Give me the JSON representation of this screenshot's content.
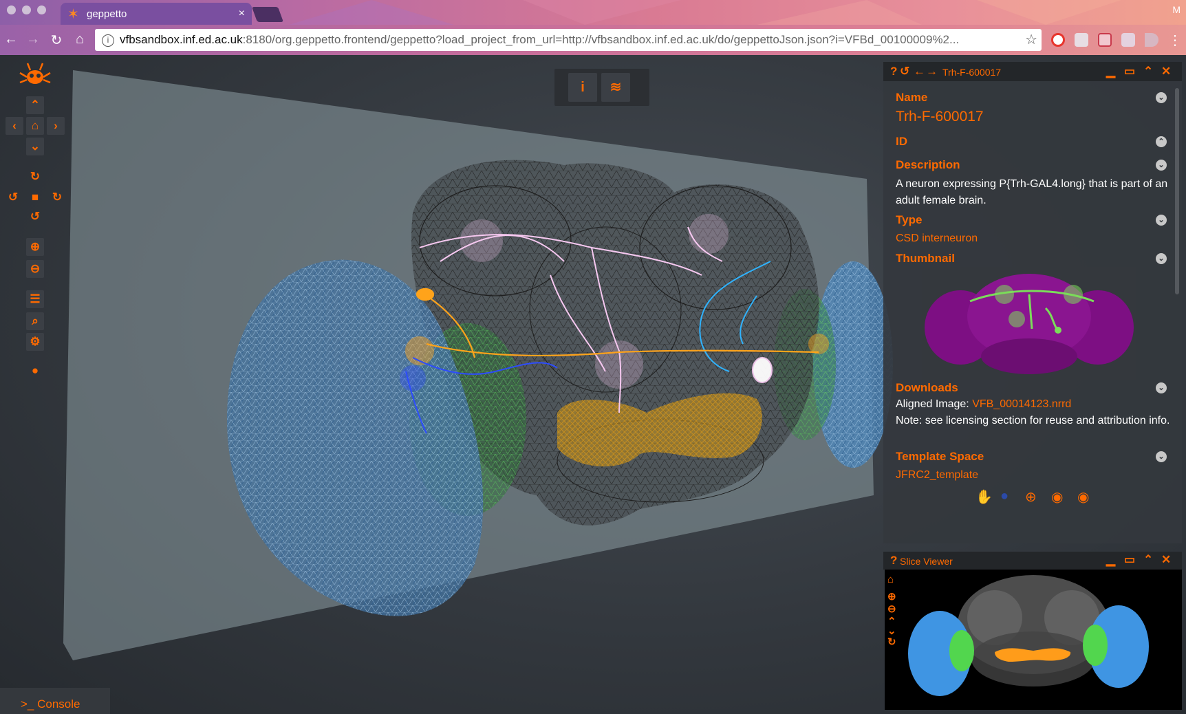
{
  "browser": {
    "tab_title": "geppetto",
    "tab_close": "×",
    "profile_initial": "M",
    "url_host": "vfbsandbox.inf.ed.ac.uk",
    "url_rest": ":8180/org.geppetto.frontend/geppetto?load_project_from_url=http://vfbsandbox.inf.ed.ac.uk/do/geppettoJson.json?i=VFBd_00100009%2..."
  },
  "console": {
    "label": ">_  Console"
  },
  "info_panel": {
    "header_title": "Trh-F-600017",
    "name_label": "Name",
    "name_value": "Trh-F-600017",
    "id_label": "ID",
    "description_label": "Description",
    "description_value": "A neuron expressing P{Trh-GAL4.long} that is part of an adult female brain.",
    "type_label": "Type",
    "type_value": "CSD interneuron",
    "thumbnail_label": "Thumbnail",
    "downloads_label": "Downloads",
    "aligned_image_prefix": "Aligned Image: ",
    "aligned_image_link": "VFB_00014123.nrrd",
    "note_text": "Note: see licensing section for reuse and attribution info.",
    "template_space_label": "Template Space",
    "template_space_value": "JFRC2_template"
  },
  "slice_viewer": {
    "title": "Slice Viewer"
  },
  "colors": {
    "accent": "#ff6a00",
    "panel_bg": "#34383d",
    "header_bg": "#232629",
    "neuron_pink": "#f6c8f0",
    "neuron_orange": "#ffa31a",
    "neuron_blue": "#2d4cff",
    "neuron_cyan": "#2fb3ff",
    "lobe_blue": "#5a8ec0",
    "lobe_green": "#56c05a",
    "mesh_gray": "#2a2a2a",
    "ellipsoid_orange": "#e4ad2d"
  },
  "icons": {
    "toolbar": [
      "up-arrow-icon",
      "left-arrow-icon",
      "home-icon",
      "right-arrow-icon",
      "down-arrow-icon",
      "rotate-up-icon",
      "rotate-left-icon",
      "camera-icon",
      "rotate-right-icon",
      "rotate-down-icon",
      "zoom-in-icon",
      "zoom-out-icon",
      "list-icon",
      "search-icon",
      "settings-icon",
      "github-icon"
    ],
    "panel_header": [
      "help-icon",
      "history-icon",
      "back-icon",
      "forward-icon",
      "minimize-icon",
      "maximize-icon",
      "collapse-icon",
      "close-icon"
    ],
    "panel_footer": [
      "hand-icon",
      "color-drop-icon",
      "zoom-icon",
      "eye-icon",
      "eye-icon"
    ]
  }
}
